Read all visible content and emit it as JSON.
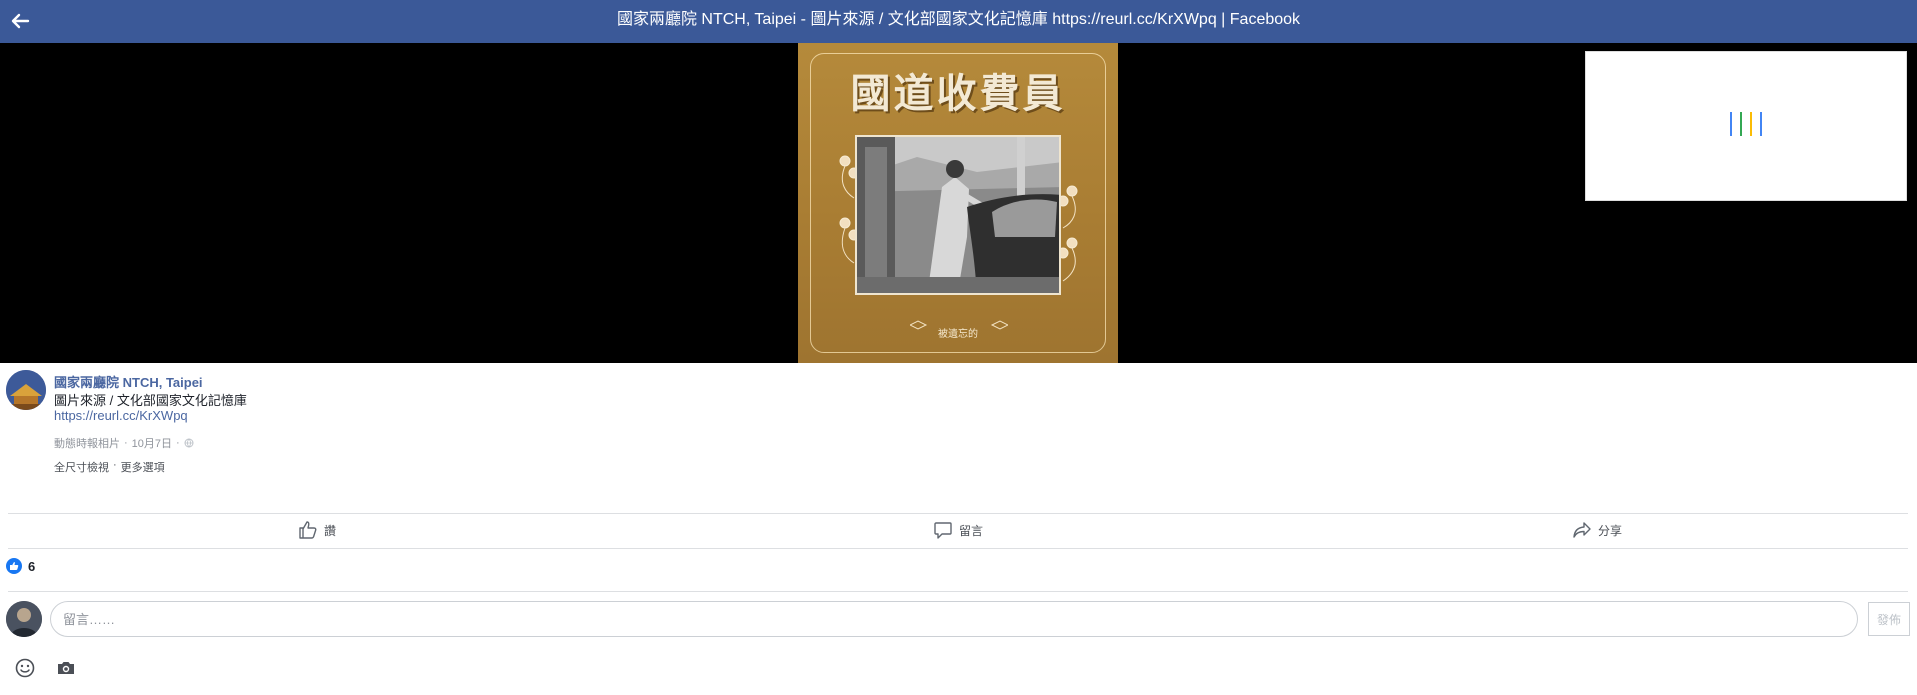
{
  "topbar": {
    "title": "國家兩廳院 NTCH, Taipei - 圖片來源 / 文化部國家文化記憶庫 https://reurl.cc/KrXWpq | Facebook",
    "back_icon": "arrow-left-icon"
  },
  "poster": {
    "title": "國道收費員",
    "subtitle": "被遺忘的"
  },
  "loader": {
    "bar_colors": [
      "#4285f4",
      "#34a853",
      "#fbbc05",
      "#4285f4"
    ]
  },
  "post": {
    "page_name": "國家兩廳院 NTCH, Taipei",
    "caption": "圖片來源 / 文化部國家文化記憶庫",
    "link": "https://reurl.cc/KrXWpq",
    "album": "動態時報相片",
    "date": "10月7日",
    "separator": "·",
    "privacy_icon": "globe-icon",
    "full_size": "全尺寸檢視",
    "more_options": "更多選項"
  },
  "actions": {
    "like": "讚",
    "comment": "留言",
    "share": "分享"
  },
  "reactions": {
    "count": "6",
    "icon": "like-icon"
  },
  "comment": {
    "placeholder": "留言……",
    "post_button": "發佈"
  },
  "colors": {
    "brand": "#3b5998",
    "link": "#4b67a1",
    "like_blue": "#1877f2"
  }
}
